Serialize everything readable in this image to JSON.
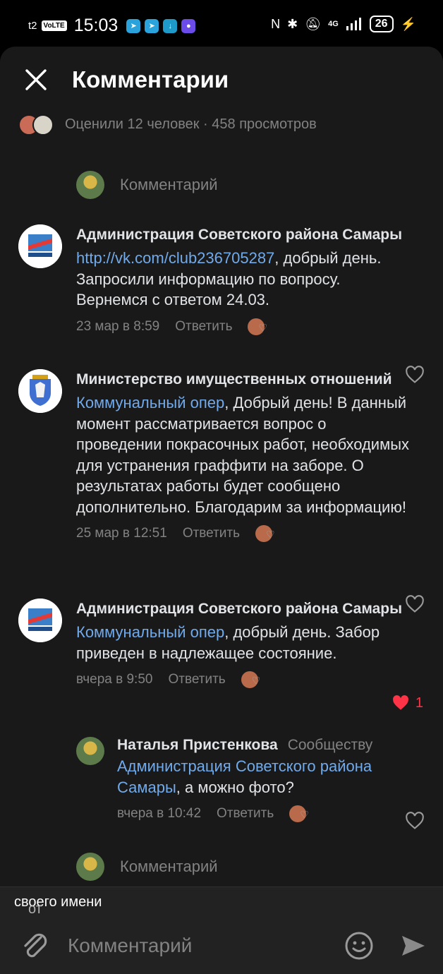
{
  "status_bar": {
    "carrier": "t2",
    "volte": "VoLTE",
    "time": "15:03",
    "network": "4G",
    "battery": "26"
  },
  "header": {
    "title": "Комментарии",
    "stats": "Оценили 12 человек · 458 просмотров"
  },
  "comment_input_placeholder": "Комментарий",
  "comments": [
    {
      "author": "Администрация Советского района Самары",
      "mention": "http://vk.com/club236705287",
      "text": ", добрый день. Запросили информацию по вопросу. Вернемся с ответом 24.03.",
      "date": "23 мар в 8:59",
      "reply_label": "Ответить",
      "likes": ""
    },
    {
      "author": "Министерство имущественных отношений",
      "mention": "Коммунальный опер",
      "text": ", Добрый день! В данный момент рассматривается вопрос о проведении  покрасочных работ, необходимых для устранения граффити на заборе. О результатах работы будет сообщено дополнительно. Благодарим за информацию!",
      "date": "25 мар в 12:51",
      "reply_label": "Ответить",
      "likes": ""
    },
    {
      "author": "Администрация Советского района Самары",
      "mention": "Коммунальный опер",
      "text": ", добрый день. Забор приведен в надлежащее состояние.",
      "date": "вчера в 9:50",
      "reply_label": "Ответить",
      "likes": "1"
    }
  ],
  "reply": {
    "author": "Наталья Пристенкова",
    "target": "Сообществу",
    "mention": "Администрация Советского района Самары",
    "text": ", а можно фото?",
    "date": "вчера в 10:42",
    "reply_label": "Ответить"
  },
  "sender": {
    "prefix": "от",
    "name": "своего имени"
  },
  "composer": {
    "placeholder": "Комментарий"
  },
  "colors": {
    "background": "#19191a",
    "link": "#71aaeb",
    "secondary_text": "#828282",
    "like_active": "#ff3347"
  }
}
